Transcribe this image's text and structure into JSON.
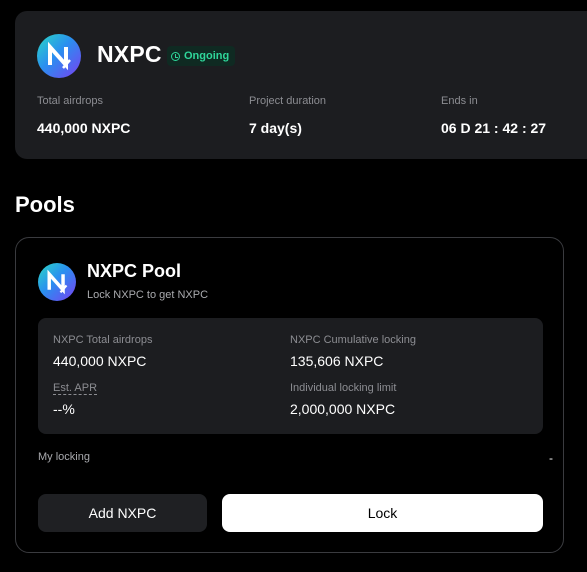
{
  "project": {
    "name": "NXPC",
    "logo_icon": "nexpace-logo-icon",
    "status": "Ongoing",
    "status_color": "#2fd69a",
    "stats": [
      {
        "label": "Total airdrops",
        "value": "440,000 NXPC"
      },
      {
        "label": "Project duration",
        "value": "7 day(s)"
      },
      {
        "label": "Ends in",
        "value": "06 D 21 : 42 : 27"
      }
    ]
  },
  "pools": {
    "heading": "Pools",
    "pool": {
      "title": "NXPC Pool",
      "subtitle": "Lock NXPC to get NXPC",
      "logo_icon": "nexpace-logo-icon",
      "stats": {
        "total_airdrops": {
          "label": "NXPC Total airdrops",
          "value": "440,000 NXPC"
        },
        "cumulative_locking": {
          "label": "NXPC Cumulative locking",
          "value": "135,606 NXPC"
        },
        "est_apr": {
          "label": "Est. APR",
          "value": "--%"
        },
        "individual_limit": {
          "label": "Individual locking limit",
          "value": "2,000,000 NXPC"
        }
      },
      "my_locking": {
        "label": "My locking",
        "value": "-"
      },
      "buttons": {
        "add": "Add NXPC",
        "lock": "Lock"
      }
    }
  }
}
